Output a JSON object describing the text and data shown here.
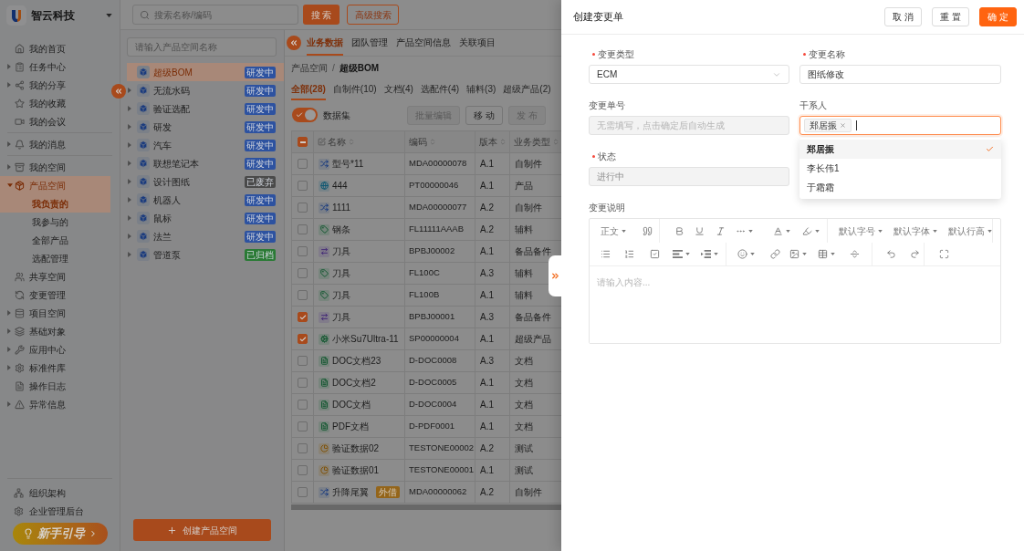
{
  "sidebar": {
    "brand": "智云科技",
    "groups": [
      [
        {
          "label": "我的首页",
          "selected": false
        },
        {
          "label": "任务中心",
          "expanded": false,
          "selected": false
        },
        {
          "label": "我的分享",
          "expanded": false,
          "selected": false
        },
        {
          "label": "我的收藏",
          "selected": false
        },
        {
          "label": "我的会议",
          "selected": false
        }
      ],
      [
        {
          "label": "我的消息",
          "expanded": false,
          "selected": false
        }
      ],
      [
        {
          "label": "我的空间",
          "expanded": false,
          "selected": false
        },
        {
          "label": "产品空间",
          "expanded": true,
          "selected": true,
          "children": [
            {
              "label": "我负责的",
              "selected": true
            },
            {
              "label": "我参与的",
              "selected": false
            },
            {
              "label": "全部产品",
              "selected": false
            },
            {
              "label": "选配管理",
              "selected": false
            }
          ]
        },
        {
          "label": "共享空间",
          "selected": false
        },
        {
          "label": "变更管理",
          "selected": false
        },
        {
          "label": "项目空间",
          "expanded": false,
          "selected": false
        },
        {
          "label": "基础对象",
          "expanded": false,
          "selected": false
        },
        {
          "label": "应用中心",
          "expanded": false,
          "selected": false
        },
        {
          "label": "标准件库",
          "expanded": false,
          "selected": false
        },
        {
          "label": "操作日志",
          "selected": false
        },
        {
          "label": "异常信息",
          "expanded": false,
          "selected": false
        }
      ]
    ],
    "footer": [
      {
        "label": "组织架构"
      },
      {
        "label": "企业管理后台"
      }
    ],
    "guide_button": "新手引导"
  },
  "top_bar": {
    "search_placeholder": "搜索名称/编码",
    "search_button": "搜 索",
    "advanced_search_button": "高级搜索"
  },
  "product_tree": {
    "search_placeholder": "请输入产品空间名称",
    "items": [
      {
        "label": "超级BOM",
        "selected": true,
        "status": {
          "label": "研发中",
          "color": "#2d52a0"
        }
      },
      {
        "label": "无流水码",
        "expanded": false,
        "selected": false,
        "status": {
          "label": "研发中",
          "color": "#2d52a0"
        }
      },
      {
        "label": "验证选配",
        "expanded": false,
        "selected": false,
        "status": {
          "label": "研发中",
          "color": "#2d52a0"
        }
      },
      {
        "label": "研发",
        "expanded": false,
        "selected": false,
        "status": {
          "label": "研发中",
          "color": "#2d52a0"
        }
      },
      {
        "label": "汽车",
        "expanded": false,
        "selected": false,
        "status": {
          "label": "研发中",
          "color": "#2d52a0"
        }
      },
      {
        "label": "联想笔记本",
        "expanded": false,
        "selected": false,
        "status": {
          "label": "研发中",
          "color": "#2d52a0"
        }
      },
      {
        "label": "设计图纸",
        "expanded": false,
        "selected": false,
        "status": {
          "label": "已废弃",
          "color": "#4a4a4a"
        }
      },
      {
        "label": "机器人",
        "expanded": false,
        "selected": false,
        "status": {
          "label": "研发中",
          "color": "#2d52a0"
        }
      },
      {
        "label": "鼠标",
        "expanded": false,
        "selected": false,
        "status": {
          "label": "研发中",
          "color": "#2d52a0"
        }
      },
      {
        "label": "法兰",
        "expanded": false,
        "selected": false,
        "status": {
          "label": "研发中",
          "color": "#2d52a0"
        }
      },
      {
        "label": "管道泵",
        "expanded": false,
        "selected": false,
        "status": {
          "label": "已归档",
          "color": "#2a7a35"
        }
      }
    ],
    "create_button": "创建产品空间"
  },
  "main": {
    "tabs": [
      {
        "label": "业务数据",
        "selected": true
      },
      {
        "label": "团队管理",
        "selected": false
      },
      {
        "label": "产品空间信息",
        "selected": false
      },
      {
        "label": "关联项目",
        "selected": false
      }
    ],
    "breadcrumb": {
      "items": [
        "产品空间",
        "超级BOM"
      ],
      "separator": "/"
    },
    "categories": [
      {
        "label": "全部(28)",
        "selected": true
      },
      {
        "label": "自制件(10)",
        "selected": false
      },
      {
        "label": "文档(4)",
        "selected": false
      },
      {
        "label": "选配件(4)",
        "selected": false
      },
      {
        "label": "辅料(3)",
        "selected": false
      },
      {
        "label": "超级产品(2)",
        "selected": false
      }
    ],
    "dataset_toggle": {
      "label": "数据集",
      "on": true
    },
    "actions": [
      {
        "label": "批量编辑",
        "disabled": true
      },
      {
        "label": "移 动",
        "disabled": false
      },
      {
        "label": "发 布",
        "disabled": true
      }
    ],
    "table": {
      "select_all": {
        "indeterminate": true
      },
      "columns": [
        {
          "label": "名称",
          "editable": true
        },
        {
          "label": "编码",
          "editable": false
        },
        {
          "label": "版本",
          "editable": false
        },
        {
          "label": "业务类型",
          "editable": false
        }
      ],
      "rows": [
        {
          "kind": "part",
          "checked": false,
          "name": "型号*11",
          "code": "MDA00000078",
          "version": "A.1",
          "type": "自制件"
        },
        {
          "kind": "product",
          "checked": false,
          "name": "444",
          "code": "PT00000046",
          "version": "A.1",
          "type": "产品"
        },
        {
          "kind": "part",
          "checked": false,
          "name": "1111",
          "code": "MDA00000077",
          "version": "A.2",
          "type": "自制件"
        },
        {
          "kind": "material",
          "checked": false,
          "name": "钢条",
          "code": "FL11111AAAB",
          "version": "A.2",
          "type": "辅料"
        },
        {
          "kind": "spare",
          "checked": false,
          "name": "刀具",
          "code": "BPBJ00002",
          "version": "A.1",
          "type": "备品备件"
        },
        {
          "kind": "material",
          "checked": false,
          "name": "刀具",
          "code": "FL100C",
          "version": "A.3",
          "type": "辅料"
        },
        {
          "kind": "material",
          "checked": false,
          "name": "刀具",
          "code": "FL100B",
          "version": "A.1",
          "type": "辅料"
        },
        {
          "kind": "spare",
          "checked": true,
          "name": "刀具",
          "code": "BPBJ00001",
          "version": "A.3",
          "type": "备品备件"
        },
        {
          "kind": "super",
          "checked": true,
          "name": "小米Su7Ultra-11",
          "code": "SP00000004",
          "version": "A.1",
          "type": "超级产品"
        },
        {
          "kind": "document",
          "checked": false,
          "name": "DOC文档23",
          "code": "D-DOC0008",
          "version": "A.3",
          "type": "文档"
        },
        {
          "kind": "document",
          "checked": false,
          "name": "DOC文档2",
          "code": "D-DOC0005",
          "version": "A.1",
          "type": "文档"
        },
        {
          "kind": "document",
          "checked": false,
          "name": "DOC文档",
          "code": "D-DOC0004",
          "version": "A.1",
          "type": "文档"
        },
        {
          "kind": "document",
          "checked": false,
          "name": "PDF文档",
          "code": "D-PDF0001",
          "version": "A.1",
          "type": "文档"
        },
        {
          "kind": "test",
          "checked": false,
          "name": "验证数据02",
          "code": "TESTONE00002",
          "version": "A.2",
          "type": "测试"
        },
        {
          "kind": "test",
          "checked": false,
          "name": "验证数据01",
          "code": "TESTONE00001",
          "version": "A.1",
          "type": "测试"
        },
        {
          "kind": "part",
          "checked": false,
          "name": "升降尾翼",
          "tag": "外借",
          "code": "MDA00000062",
          "version": "A.2",
          "type": "自制件"
        }
      ]
    }
  },
  "drawer": {
    "title": "创建变更单",
    "buttons": [
      {
        "label": "取 消",
        "kind": "default"
      },
      {
        "label": "重 置",
        "kind": "default"
      },
      {
        "label": "确 定",
        "kind": "primary"
      }
    ],
    "fields": [
      {
        "label": "变更类型",
        "required": true,
        "kind": "select",
        "value": "ECM",
        "disabled": false,
        "focused": false
      },
      {
        "label": "变更名称",
        "required": true,
        "kind": "input",
        "value": "图纸修改",
        "disabled": false,
        "focused": false
      },
      {
        "label": "变更单号",
        "required": false,
        "kind": "input",
        "placeholder": "无需填写，点击确定后自动生成",
        "disabled": true,
        "focused": false
      },
      {
        "label": "干系人",
        "required": false,
        "kind": "tags",
        "tags": [
          "郑居振"
        ],
        "disabled": false,
        "focused": true,
        "open": true,
        "options": [
          {
            "label": "郑居振",
            "selected": true
          },
          {
            "label": "李长伟1",
            "selected": false
          },
          {
            "label": "于霜霜",
            "selected": false
          }
        ]
      },
      {
        "label": "状态",
        "required": true,
        "kind": "input",
        "value": "进行中",
        "disabled": true,
        "focused": false
      }
    ],
    "description": {
      "label": "变更说明",
      "toolbar": {
        "paragraph": "正文",
        "font_size": "默认字号",
        "font_family": "默认字体",
        "line_height": "默认行高"
      },
      "placeholder": "请输入内容..."
    }
  }
}
